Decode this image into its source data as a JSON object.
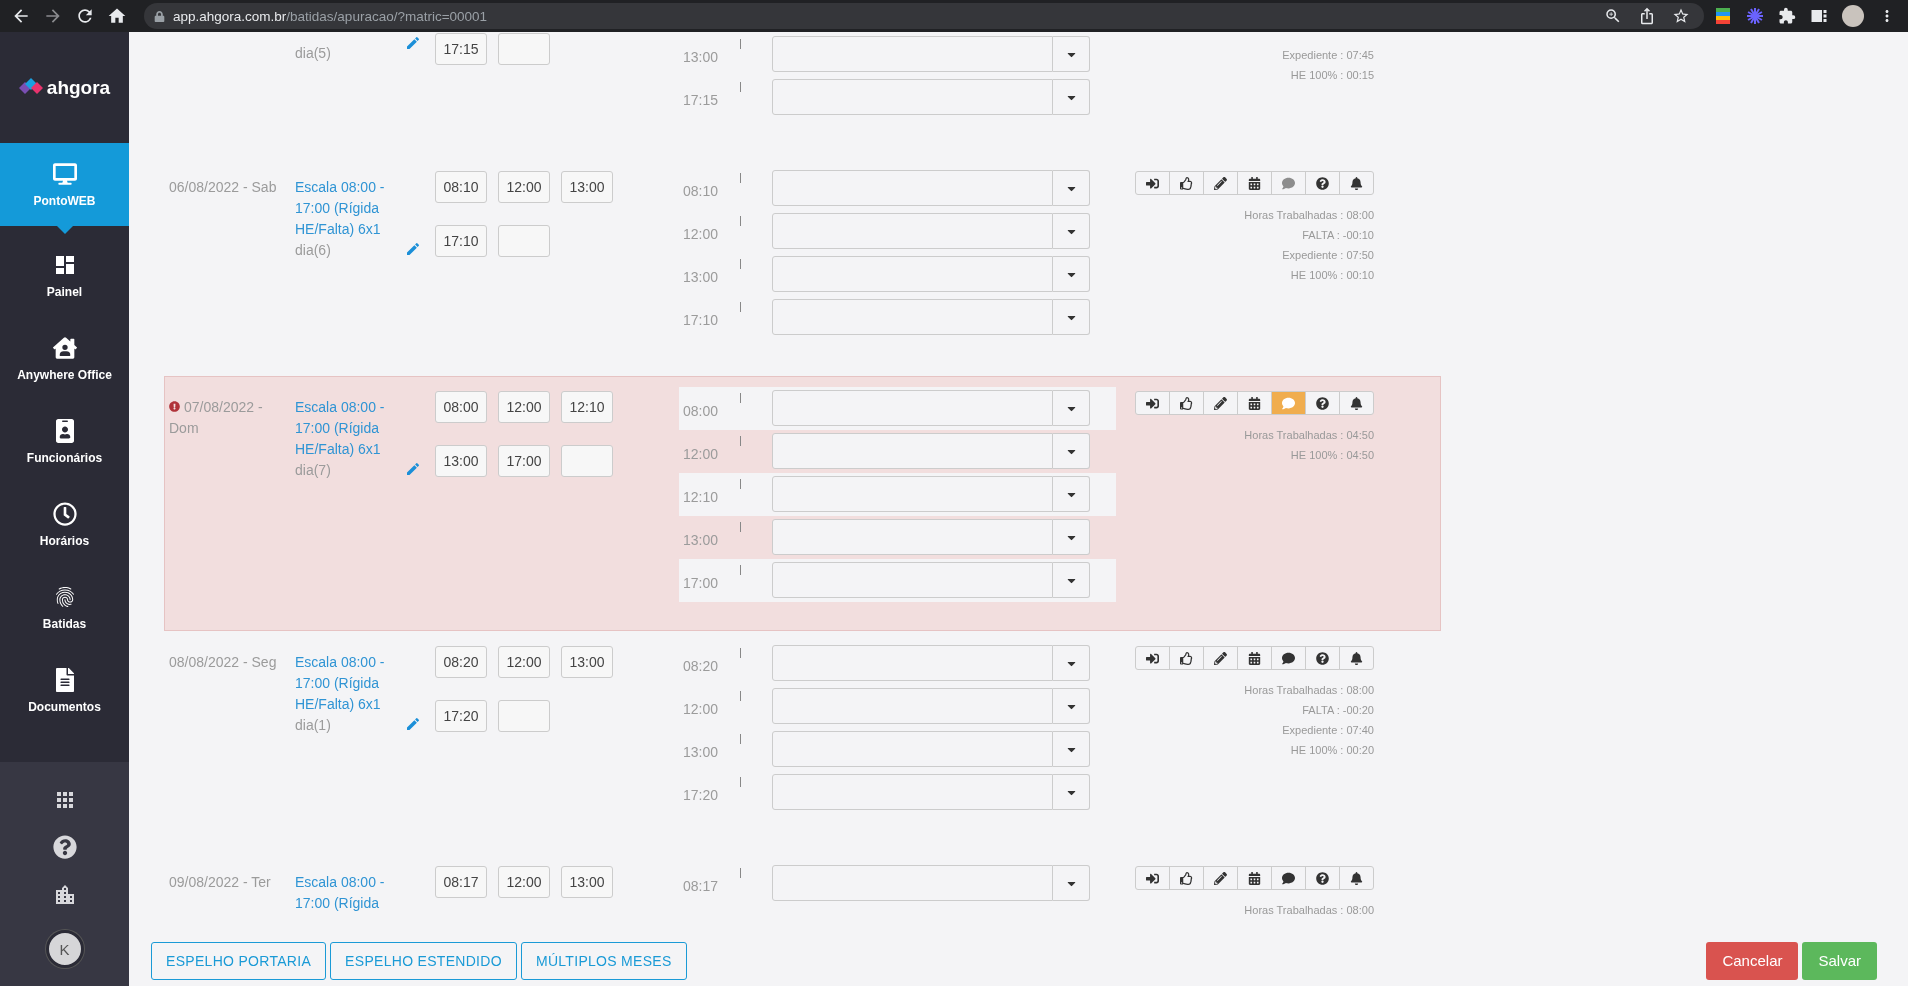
{
  "browser": {
    "url_host": "app.ahgora.com.br",
    "url_path": "/batidas/apuracao/?matric=00001"
  },
  "sidebar": {
    "logo": "ahgora",
    "items": [
      {
        "label": "PontoWEB",
        "selected": true
      },
      {
        "label": "Painel",
        "selected": false
      },
      {
        "label": "Anywhere Office",
        "selected": false
      },
      {
        "label": "Funcionários",
        "selected": false
      },
      {
        "label": "Horários",
        "selected": false
      },
      {
        "label": "Batidas",
        "selected": false
      },
      {
        "label": "Documentos",
        "selected": false
      }
    ],
    "avatar": "K"
  },
  "rows": [
    {
      "alert": false,
      "day": "dia(5)",
      "boxes": [
        {
          "kind": "time",
          "value": "17:15"
        },
        {
          "kind": "blank"
        }
      ],
      "punches": [
        {
          "time": "13:00"
        },
        {
          "time": "17:15"
        }
      ],
      "stats": [
        "Expediente : 07:45",
        "HE 100% : 00:15"
      ]
    },
    {
      "alert": false,
      "date": "06/08/2022 - Sab",
      "schedule": "Escala 08:00 - 17:00 (Rígida HE/Falta) 6x1",
      "day": "dia(6)",
      "boxes": [
        {
          "kind": "time",
          "value": "08:10"
        },
        {
          "kind": "time",
          "value": "12:00"
        },
        {
          "kind": "time",
          "value": "13:00"
        },
        {
          "kind": "time",
          "value": "17:10"
        },
        {
          "kind": "blank"
        }
      ],
      "punches": [
        {
          "time": "08:10"
        },
        {
          "time": "12:00"
        },
        {
          "time": "13:00"
        },
        {
          "time": "17:10"
        }
      ],
      "comment": {
        "filled": false,
        "highlighted": false
      },
      "stats": [
        "Horas Trabalhadas : 08:00",
        "FALTA : -00:10",
        "Expediente : 07:50",
        "HE 100% : 00:10"
      ]
    },
    {
      "alert": true,
      "date": "07/08/2022 - Dom",
      "schedule": "Escala 08:00 - 17:00 (Rígida HE/Falta) 6x1",
      "day": "dia(7)",
      "boxes": [
        {
          "kind": "time",
          "value": "08:00"
        },
        {
          "kind": "time",
          "value": "12:00"
        },
        {
          "kind": "time",
          "value": "12:10"
        },
        {
          "kind": "time",
          "value": "13:00"
        },
        {
          "kind": "time",
          "value": "17:00"
        },
        {
          "kind": "blank"
        }
      ],
      "punches": [
        {
          "time": "08:00"
        },
        {
          "time": "12:00"
        },
        {
          "time": "12:10"
        },
        {
          "time": "13:00"
        },
        {
          "time": "17:00"
        }
      ],
      "comment": {
        "filled": true,
        "highlighted": true
      },
      "stats": [
        "Horas Trabalhadas : 04:50",
        "HE 100% : 04:50"
      ]
    },
    {
      "alert": false,
      "date": "08/08/2022 - Seg",
      "schedule": "Escala 08:00 - 17:00 (Rígida HE/Falta) 6x1",
      "day": "dia(1)",
      "boxes": [
        {
          "kind": "time",
          "value": "08:20"
        },
        {
          "kind": "time",
          "value": "12:00"
        },
        {
          "kind": "time",
          "value": "13:00"
        },
        {
          "kind": "time",
          "value": "17:20"
        },
        {
          "kind": "blank"
        }
      ],
      "punches": [
        {
          "time": "08:20"
        },
        {
          "time": "12:00"
        },
        {
          "time": "13:00"
        },
        {
          "time": "17:20"
        }
      ],
      "comment": {
        "filled": true,
        "highlighted": false
      },
      "stats": [
        "Horas Trabalhadas : 08:00",
        "FALTA : -00:20",
        "Expediente : 07:40",
        "HE 100% : 00:20"
      ]
    },
    {
      "alert": false,
      "date": "09/08/2022 - Ter",
      "schedule": "Escala 08:00 - 17:00 (Rígida",
      "boxes": [
        {
          "kind": "time",
          "value": "08:17"
        },
        {
          "kind": "time",
          "value": "12:00"
        },
        {
          "kind": "time",
          "value": "13:00"
        }
      ],
      "punches": [
        {
          "time": "08:17"
        }
      ],
      "comment": {
        "filled": true,
        "highlighted": false
      },
      "stats": [
        "Horas Trabalhadas : 08:00"
      ]
    }
  ],
  "footer": {
    "left_buttons": [
      "ESPELHO PORTARIA",
      "ESPELHO ESTENDIDO",
      "MÚLTIPLOS MESES"
    ],
    "cancel": "Cancelar",
    "save": "Salvar"
  }
}
